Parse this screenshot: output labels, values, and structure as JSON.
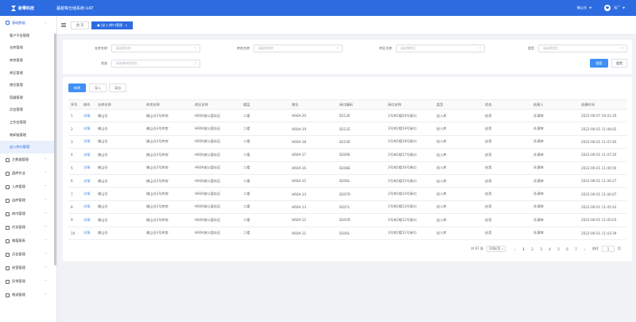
{
  "header": {
    "brand": "新零科技",
    "system_title": "蔓越莓仓储系统-UAT",
    "warehouse": "佛山仓",
    "user": "无厂"
  },
  "sidebar": {
    "group": "基础数据",
    "items": [
      "客户平台管理",
      "仓库管理",
      "库房管理",
      "库区管理",
      "储位管理",
      "容器管理",
      "月台管理",
      "工作台管理",
      "装卸链管理",
      "出入库口管理"
    ],
    "collapsed_groups": [
      "主数据管理",
      "盘库作业",
      "入库管理",
      "出库管理",
      "库内管理",
      "任务管理",
      "储值报表",
      "月台管理",
      "经营管理",
      "异常管理",
      "物流管理"
    ]
  },
  "tabs": [
    {
      "label": "首 页"
    },
    {
      "label": "出(入)库口管理",
      "close": "×"
    }
  ],
  "filters": {
    "warehouse_label": "仓库名称",
    "warehouse_placeholder": "请选择仓库",
    "storehouse_label": "库房名称",
    "storehouse_placeholder": "请选择库房",
    "area_label": "库区名称",
    "area_placeholder": "请选择库区",
    "type_label": "类型",
    "type_placeholder": "请选择类型",
    "status_label": "状态",
    "status_placeholder": "请选择库房状态",
    "search_button": "搜索",
    "reset_button": "重置"
  },
  "toolbar": {
    "add": "新增",
    "import": "导入",
    "export": "导出"
  },
  "table": {
    "columns": [
      "序号",
      "操作",
      "仓库名称",
      "库房名称",
      "库区名称",
      "楼层",
      "储位",
      "接口编码",
      "接口名称",
      "类型",
      "状态",
      "创建人",
      "创建时间"
    ],
    "rows": [
      [
        "1",
        "详情",
        "佛山仓",
        "佛山仓2号库房",
        "H60A放公暂存区",
        "二楼",
        "H60A-20",
        "B212E",
        "2号库2楼20号接口",
        "出入库",
        "启用",
        "孙满坤",
        "2022-06-07 16:41:20"
      ],
      [
        "2",
        "详情",
        "佛山仓",
        "佛山仓2号库房",
        "H60A放公暂存区",
        "二楼",
        "H60A-19",
        "B211E",
        "2号库2楼19号接口",
        "出入库",
        "启用",
        "孙满坤",
        "2022-06-01 11:48:02"
      ],
      [
        "3",
        "详情",
        "佛山仓",
        "佛山仓2号库房",
        "H60A放公暂存区",
        "二楼",
        "H60A-18",
        "B210E",
        "2号库2楼18号接口",
        "出入库",
        "启用",
        "孙满坤",
        "2022-06-01 11:47:40"
      ],
      [
        "4",
        "详情",
        "佛山仓",
        "佛山仓2号库房",
        "H60A放公暂存区",
        "二楼",
        "H60A-17",
        "B209E",
        "2号库2楼17号接口",
        "出入库",
        "启用",
        "孙满坤",
        "2022-06-01 11:47:20"
      ],
      [
        "5",
        "详情",
        "佛山仓",
        "佛山仓2号库房",
        "H60A放公暂存区",
        "二楼",
        "H60A-16",
        "B208E",
        "2号库2楼16号接口",
        "出入库",
        "启用",
        "孙满坤",
        "2022-06-01 11:46:50"
      ],
      [
        "6",
        "详情",
        "佛山仓",
        "佛山仓2号库房",
        "H60A放公暂存区",
        "二楼",
        "H60A-15",
        "B206L",
        "2号库2楼15号接口",
        "出入库",
        "启用",
        "孙满坤",
        "2022-06-01 11:46:27"
      ],
      [
        "7",
        "详情",
        "佛山仓",
        "佛山仓2号库房",
        "H60A放公暂存区",
        "二楼",
        "H60A-14",
        "B207R",
        "2号库2楼14号接口",
        "出入库",
        "启用",
        "孙满坤",
        "2022-06-01 11:46:07"
      ],
      [
        "8",
        "详情",
        "佛山仓",
        "佛山仓2号库房",
        "H60A放公暂存区",
        "二楼",
        "H60A-13",
        "B207L",
        "2号库2楼13号接口",
        "出入库",
        "启用",
        "孙满坤",
        "2022-06-01 11:45:43"
      ],
      [
        "9",
        "详情",
        "佛山仓",
        "佛山仓2号库房",
        "H60A放公暂存区",
        "二楼",
        "H60A-12",
        "B205R",
        "2号库2楼12号接口",
        "出入库",
        "启用",
        "孙满坤",
        "2022-06-01 11:45:03"
      ],
      [
        "10",
        "详情",
        "佛山仓",
        "佛山仓2号库房",
        "H60A放公暂存区",
        "二楼",
        "H60A-11",
        "B206L",
        "2号库2楼11号接口",
        "出入库",
        "启用",
        "孙满坤",
        "2022-06-01 11:43:39"
      ]
    ]
  },
  "pagination": {
    "total": "共 67 条",
    "page_size": "10条/页",
    "prev": "‹",
    "pages": [
      "1",
      "2",
      "3",
      "4",
      "5",
      "6",
      "7"
    ],
    "next": "›",
    "goto_label": "前往",
    "goto_value": "1",
    "goto_suffix": "页"
  },
  "colors": {
    "primary": "#2d6be0",
    "button": "#3f8ff7"
  }
}
